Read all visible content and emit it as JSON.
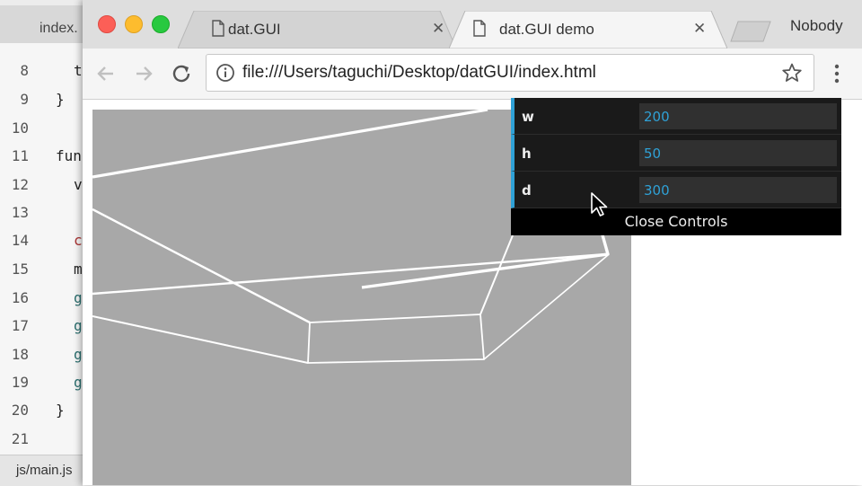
{
  "editor": {
    "tab_label": "index.",
    "status_label": "js/main.js",
    "lines": [
      {
        "num": "8",
        "code": "t"
      },
      {
        "num": "9",
        "code": "}"
      },
      {
        "num": "10",
        "code": ""
      },
      {
        "num": "11",
        "code": "fun"
      },
      {
        "num": "12",
        "code": "v"
      },
      {
        "num": "13",
        "code": ""
      },
      {
        "num": "14",
        "code": "c"
      },
      {
        "num": "15",
        "code": "m"
      },
      {
        "num": "16",
        "code": "g"
      },
      {
        "num": "17",
        "code": "g"
      },
      {
        "num": "18",
        "code": "g"
      },
      {
        "num": "19",
        "code": "g"
      },
      {
        "num": "20",
        "code": "}"
      },
      {
        "num": "21",
        "code": ""
      }
    ]
  },
  "browser": {
    "tabs": [
      {
        "label": "dat.GUI",
        "active": false
      },
      {
        "label": "dat.GUI demo",
        "active": true
      }
    ],
    "profile": "Nobody",
    "url": "file:///Users/taguchi/Desktop/datGUI/index.html",
    "canvas_bg": "#a8a8a8"
  },
  "gui": {
    "rows": [
      {
        "label": "w",
        "value": "200"
      },
      {
        "label": "h",
        "value": "50"
      },
      {
        "label": "d",
        "value": "300"
      }
    ],
    "close_label": "Close Controls",
    "accent": "#2fa1d6"
  },
  "icons": {
    "back": "arrow-left-icon",
    "forward": "arrow-right-icon",
    "reload": "reload-icon",
    "info": "info-icon",
    "star": "star-icon",
    "menu": "vertical-dots-icon",
    "page": "page-icon",
    "close": "close-icon"
  }
}
